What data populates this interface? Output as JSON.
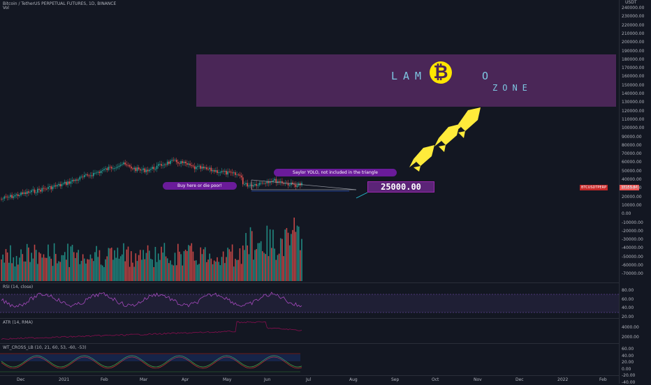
{
  "header": {
    "symbol_title": "Bitcoin / TetherUS PERPETUAL FUTURES, 1D, BINANCE",
    "vol_label": "Vol"
  },
  "currency": "USDT",
  "price_axis": [
    "240000.00",
    "230000.00",
    "220000.00",
    "210000.00",
    "200000.00",
    "190000.00",
    "180000.00",
    "170000.00",
    "160000.00",
    "150000.00",
    "140000.00",
    "130000.00",
    "120000.00",
    "110000.00",
    "100000.00",
    "90000.00",
    "80000.00",
    "70000.00",
    "60000.00",
    "50000.00",
    "40000.00",
    "30000.00",
    "20000.00",
    "10000.00",
    "0.00",
    "-10000.00",
    "-20000.00",
    "-30000.00",
    "-40000.00",
    "-50000.00",
    "-60000.00",
    "-70000.00"
  ],
  "rsi_axis": [
    "80.00",
    "60.00",
    "40.00",
    "20.00"
  ],
  "atr_axis": [
    "4000.00",
    "2000.00"
  ],
  "wt_axis": [
    "60.00",
    "40.00",
    "20.00",
    "0.00",
    "-20.00",
    "-40.00"
  ],
  "time_axis": [
    "Dec",
    "2021",
    "Feb",
    "Mar",
    "Apr",
    "May",
    "Jun",
    "Jul",
    "Aug",
    "Sep",
    "Oct",
    "Nov",
    "Dec",
    "2022",
    "Feb"
  ],
  "indicators": {
    "rsi": "RSI (14, close)",
    "atr": "ATR (14, RMA)",
    "wt": "WT_CROSS_LB (10, 21, 60, 53, -60, -53)"
  },
  "annotations": {
    "lambo_top": "LAM",
    "lambo_o": "O",
    "lambo_zone": "ZONE",
    "bitcoin_symbol": "₿",
    "buy_bubble": "Buy here or die poor!",
    "saylor_bubble": "Saylor YOLO, not included in the triangle",
    "price_target": "25000.00"
  },
  "tags": {
    "symbol_tag": "BTCUSDTPERP",
    "price_tag": "33155.84"
  },
  "colors": {
    "up": "#26a69a",
    "down": "#ef5350",
    "lambo_bg": "#4a2657",
    "accent": "#9c27b0",
    "rocket": "#ffeb3b"
  }
}
